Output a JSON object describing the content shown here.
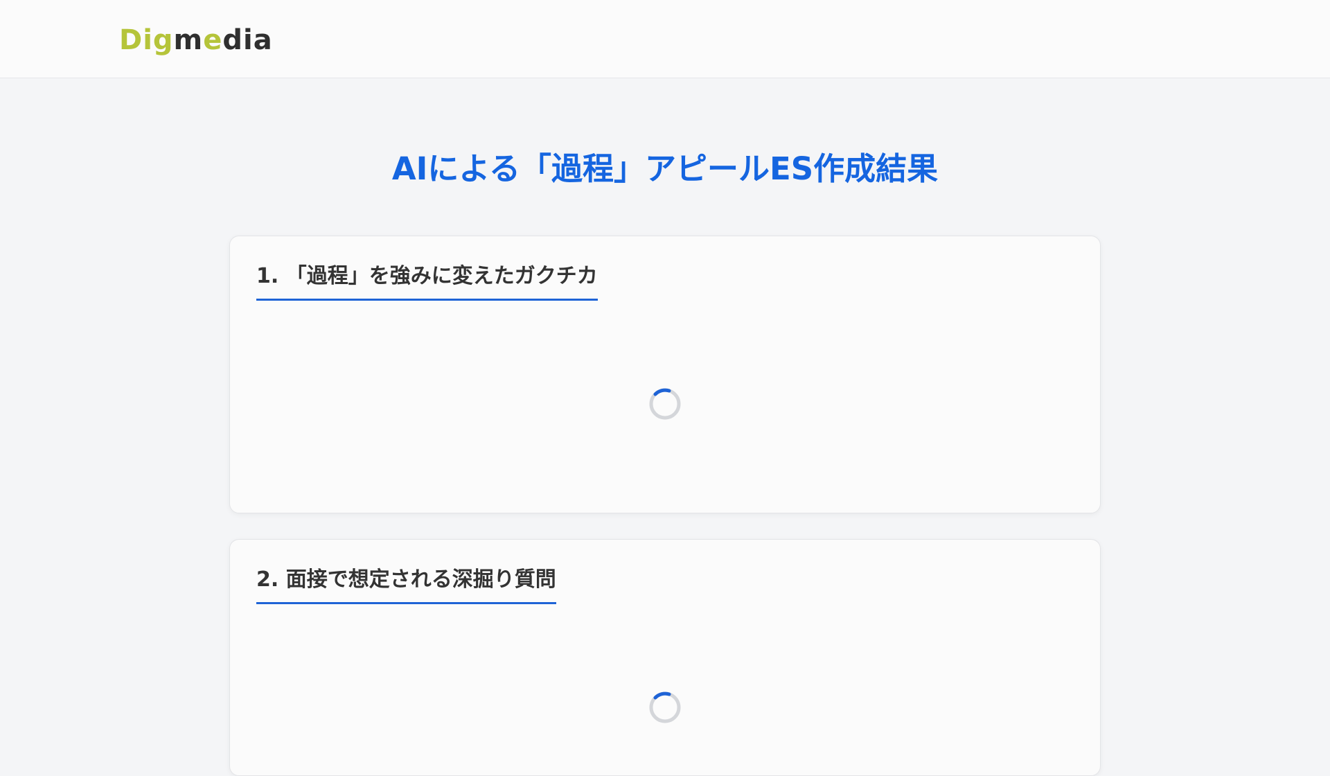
{
  "header": {
    "logo_text_dig": "Dig",
    "logo_text_m": "m",
    "logo_text_e": "e",
    "logo_text_dia": "dia",
    "logo_alt": "Digmedia"
  },
  "page": {
    "title": "AIによる「過程」アピールES作成結果"
  },
  "sections": [
    {
      "heading": "1. 「過程」を強みに変えたガクチカ",
      "status": "loading"
    },
    {
      "heading": "2. 面接で想定される深掘り質問",
      "status": "loading"
    }
  ],
  "colors": {
    "accent": "#1565e0",
    "logo_green": "#b5c43a",
    "spinner_track": "#d4d6da",
    "spinner_arc": "#1e63d6"
  },
  "icons": {
    "spinner": "loading-spinner-icon"
  }
}
